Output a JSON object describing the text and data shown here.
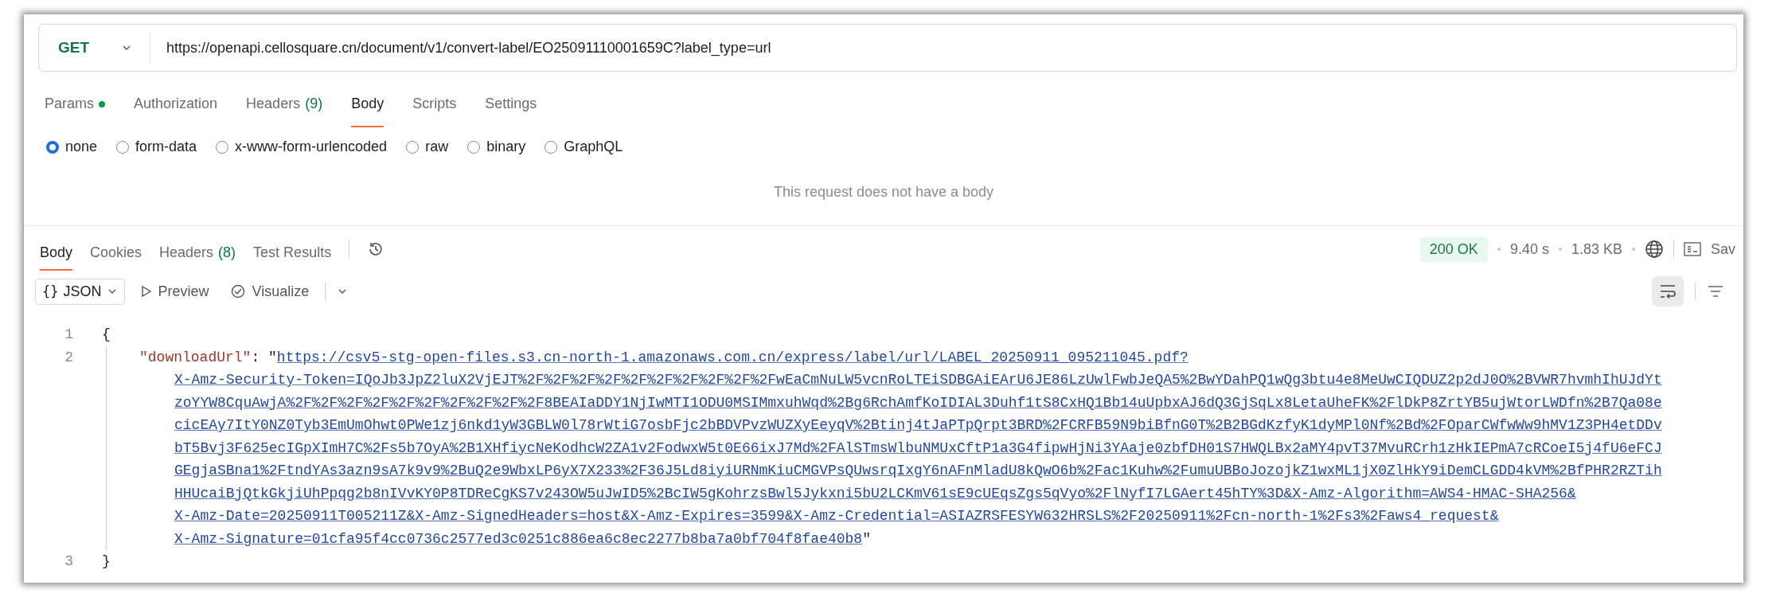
{
  "request": {
    "method": "GET",
    "url": "https://openapi.cellosquare.cn/document/v1/convert-label/EO25091110001659C?label_type=url"
  },
  "request_tabs": [
    {
      "label": "Params",
      "dot": true,
      "selected": false
    },
    {
      "label": "Authorization",
      "dot": false,
      "selected": false
    },
    {
      "label": "Headers",
      "count": "(9)",
      "dot": false,
      "selected": false
    },
    {
      "label": "Body",
      "dot": false,
      "selected": true
    },
    {
      "label": "Scripts",
      "dot": false,
      "selected": false
    },
    {
      "label": "Settings",
      "dot": false,
      "selected": false
    }
  ],
  "body_types": [
    {
      "label": "none",
      "selected": true
    },
    {
      "label": "form-data",
      "selected": false
    },
    {
      "label": "x-www-form-urlencoded",
      "selected": false
    },
    {
      "label": "raw",
      "selected": false
    },
    {
      "label": "binary",
      "selected": false
    },
    {
      "label": "GraphQL",
      "selected": false
    }
  ],
  "empty_body_message": "This request does not have a body",
  "response_tabs": [
    {
      "label": "Body",
      "selected": true
    },
    {
      "label": "Cookies",
      "selected": false
    },
    {
      "label": "Headers",
      "count": "(8)",
      "selected": false
    },
    {
      "label": "Test Results",
      "selected": false
    }
  ],
  "response_meta": {
    "status": "200 OK",
    "time": "9.40 s",
    "size": "1.83 KB",
    "save_label": "Sav"
  },
  "viewer": {
    "format_glyph": "{}",
    "format": "JSON",
    "preview": "Preview",
    "visualize": "Visualize",
    "wrap_selected": true
  },
  "code": [
    {
      "kind": "text",
      "number": "1",
      "text": "{"
    },
    {
      "kind": "pair",
      "number": "2",
      "key": "\"downloadUrl\"",
      "separator": ": \"",
      "closing": "\"",
      "url_lines": [
        "https://csv5-stg-open-files.s3.cn-north-1.amazonaws.com.cn/express/label/url/LABEL_20250911_095211045.pdf?",
        "X-Amz-Security-Token=IQoJb3JpZ2luX2VjEJT%2F%2F%2F%2F%2F%2F%2F%2F%2F%2FwEaCmNuLW5vcnRoLTEiSDBGAiEArU6JE86LzUwlFwbJeQA5%2BwYDahPQ1wQg3btu4e8MeUwCIQDUZ2p2dJ0O%2BVWR7hvmhIhUJdYt",
        "zoYYW8CquAwjA%2F%2F%2F%2F%2F%2F%2F%2F%2F%2F8BEAIaDDY1NjIwMTI1ODU0MSIMmxuhWqd%2Bg6RchAmfKoIDIAL3Duhf1tS8CxHQ1Bb14uUpbxAJ6dQ3GjSqLx8LetaUheFK%2FlDkP8ZrtYB5ujWtorLWDfn%2B7Qa08e",
        "cicEAy7ItY0NZ0Tyb3EmUmOhwt0PWe1zj6nkd1yW3GBLW0l78rWtiG7osbFjc2bBDVPvzWUZXyEeyqV%2Btinj4tJaPTpQrpt3BRD%2FCRFB59N9biBfnG0T%2B2BGdKzfyK1dyMPl0Nf%2Bd%2FOparCWfwWw9hMV1Z3PH4etDDv",
        "bT5Bvj3F625ecIGpXImH7C%2Fs5b7OyA%2B1XHfiycNeKodhcW2ZA1v2FodwxW5t0E66ixJ7Md%2FAlSTmsWlbuNMUxCftP1a3G4fipwHjNi3YAaje0zbfDH01S7HWQLBx2aMY4pvT37MvuRCrh1zHkIEPmA7cRCoeI5j4fU6eFCJ",
        "GEgjaSBna1%2FtndYAs3azn9sA7k9v9%2BuQ2e9WbxLP6yX7X233%2F36J5Ld8iyiURNmKiuCMGVPsQUwsrqIxgY6nAFnMladU8kQwO6b%2Fac1Kuhw%2FumuUBBoJozojkZ1wxML1jX0ZlHkY9iDemCLGDD4kVM%2BfPHR2RZTih",
        "HHUcaiBjQtkGkjiUhPpqg2b8nIVvKY0P8TDReCgKS7v243OW5uJwID5%2BcIW5gKohrzsBwl5Jykxni5bU2LCKmV61sE9cUEqsZgs5qVyo%2FlNyfI7LGAert45hTY%3D&X-Amz-Algorithm=AWS4-HMAC-SHA256&",
        "X-Amz-Date=20250911T005211Z&X-Amz-SignedHeaders=host&X-Amz-Expires=3599&X-Amz-Credential=ASIAZRSFESYW632HRSLS%2F20250911%2Fcn-north-1%2Fs3%2Faws4_request&",
        "X-Amz-Signature=01cfa95f4cc0736c2577ed3c0251c886ea6c8ec2277b8ba7a0bf704f8fae40b8"
      ]
    },
    {
      "kind": "text",
      "number": "3",
      "text": "}"
    }
  ]
}
